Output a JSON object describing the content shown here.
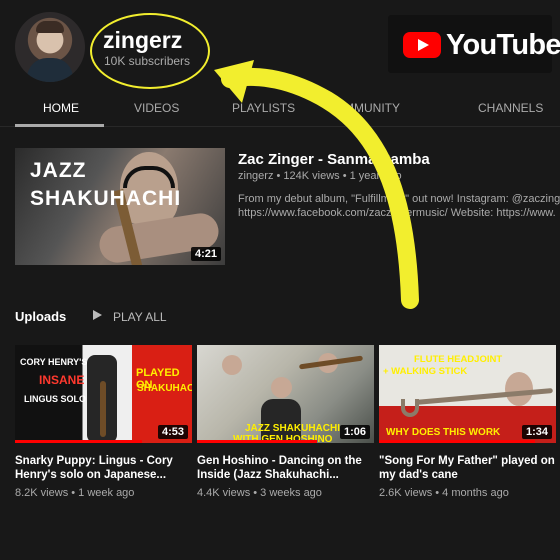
{
  "channel": {
    "name": "zingerz",
    "subscribers": "10K subscribers"
  },
  "logo": {
    "text": "YouTube",
    "brand_red": "#ff0000"
  },
  "tabs": [
    {
      "label": "HOME"
    },
    {
      "label": "VIDEOS"
    },
    {
      "label": "PLAYLISTS"
    },
    {
      "label": "COMMUNITY"
    },
    {
      "label": "CHANNELS"
    }
  ],
  "featured": {
    "thumbnail_text_1": "JAZZ",
    "thumbnail_text_2": "SHAKUHACHI",
    "duration": "4:21",
    "title": "Zac Zinger - Sanma Samba",
    "meta": "zingerz • 124K views • 1 year ago",
    "description_line_1": "From my debut album, \"Fulfillment\" out now! Instagram: @zaczinger",
    "description_line_2": "https://www.facebook.com/zaczingermusic/ Website: https://www."
  },
  "uploads": {
    "label": "Uploads",
    "play_all": "PLAY ALL",
    "play_icon": "play-icon",
    "items": [
      {
        "duration": "4:53",
        "title": "Snarky Puppy: Lingus - Cory Henry's solo on Japanese...",
        "meta": "8.2K views • 1 week ago",
        "thumb_text_1": "CORY HENRY'S",
        "thumb_text_2": "INSANE",
        "thumb_text_3": "LINGUS SOLO",
        "thumb_text_4": "PLAYED ON",
        "thumb_text_5": "SHAKUHACHI",
        "progress": 0.72
      },
      {
        "duration": "1:06",
        "title": "Gen Hoshino - Dancing on the Inside (Jazz Shakuhachi...",
        "meta": "4.4K views • 3 weeks ago",
        "thumb_text_1": "JAZZ SHAKUHACHI",
        "thumb_text_2": "WITH GEN HOSHINO",
        "progress": 0.68
      },
      {
        "duration": "1:34",
        "title": "\"Song For My Father\" played on my dad's cane",
        "meta": "2.6K views • 4 months ago",
        "thumb_text_1": "FLUTE HEADJOINT",
        "thumb_text_2": "+ WALKING STICK",
        "thumb_text_3": "WHY DOES THIS WORK",
        "progress": 0.88
      }
    ]
  },
  "annotation": {
    "color": "#f2ee2e"
  }
}
